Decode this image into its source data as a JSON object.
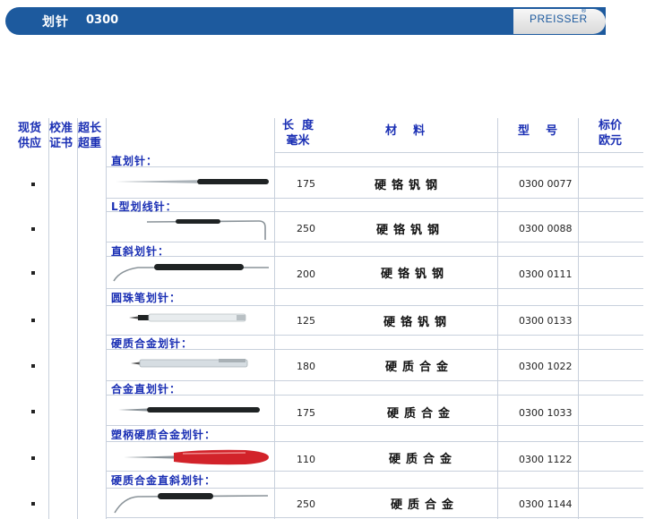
{
  "header": {
    "title": "划针",
    "code": "0300",
    "brand": "PREISSER",
    "reg_mark": "®"
  },
  "columns": {
    "stock": "现货\n供应",
    "certificate": "校准\n证书",
    "extra_long": "超长\n超重",
    "length": "长  度\n毫米",
    "material": "材    料",
    "model": "型    号",
    "price": "标价\n欧元"
  },
  "rows": [
    {
      "category": "直划针：",
      "stock": "•",
      "length": "175",
      "material": "硬铬钒钢",
      "part_no": "0300 0077",
      "tool": "straight-scriber"
    },
    {
      "category": "L型划线针：",
      "stock": "•",
      "length": "250",
      "material": "硬铬钒钢",
      "part_no": "0300 0088",
      "tool": "l-shaped-scriber"
    },
    {
      "category": "直斜划针：",
      "stock": "•",
      "length": "200",
      "material": "硬铬钒钢",
      "part_no": "0300 0111",
      "tool": "bent-scriber"
    },
    {
      "category": "圆珠笔划针：",
      "stock": "•",
      "length": "125",
      "material": "硬铬钒钢",
      "part_no": "0300 0133",
      "tool": "pen-scriber"
    },
    {
      "category": "硬质合金划针：",
      "stock": "•",
      "length": "180",
      "material": "硬质合金",
      "part_no": "0300 1022",
      "tool": "carbide-pen-scriber"
    },
    {
      "category": "合金直划针：",
      "stock": "•",
      "length": "175",
      "material": "硬质合金",
      "part_no": "0300 1033",
      "tool": "alloy-straight-scriber"
    },
    {
      "category": "塑柄硬质合金划针：",
      "stock": "•",
      "length": "110",
      "material": "硬质合金",
      "part_no": "0300 1122",
      "tool": "plastic-handle-scriber"
    },
    {
      "category": "硬质合金直斜划针：",
      "stock": "•",
      "length": "250",
      "material": "硬质合金",
      "part_no": "0300 1144",
      "tool": "carbide-bent-scriber"
    }
  ],
  "colors": {
    "banner": "#1d5a9e",
    "header_text": "#1a2fb4",
    "grip_black": "#1f2324",
    "handle_red": "#d2232a"
  }
}
